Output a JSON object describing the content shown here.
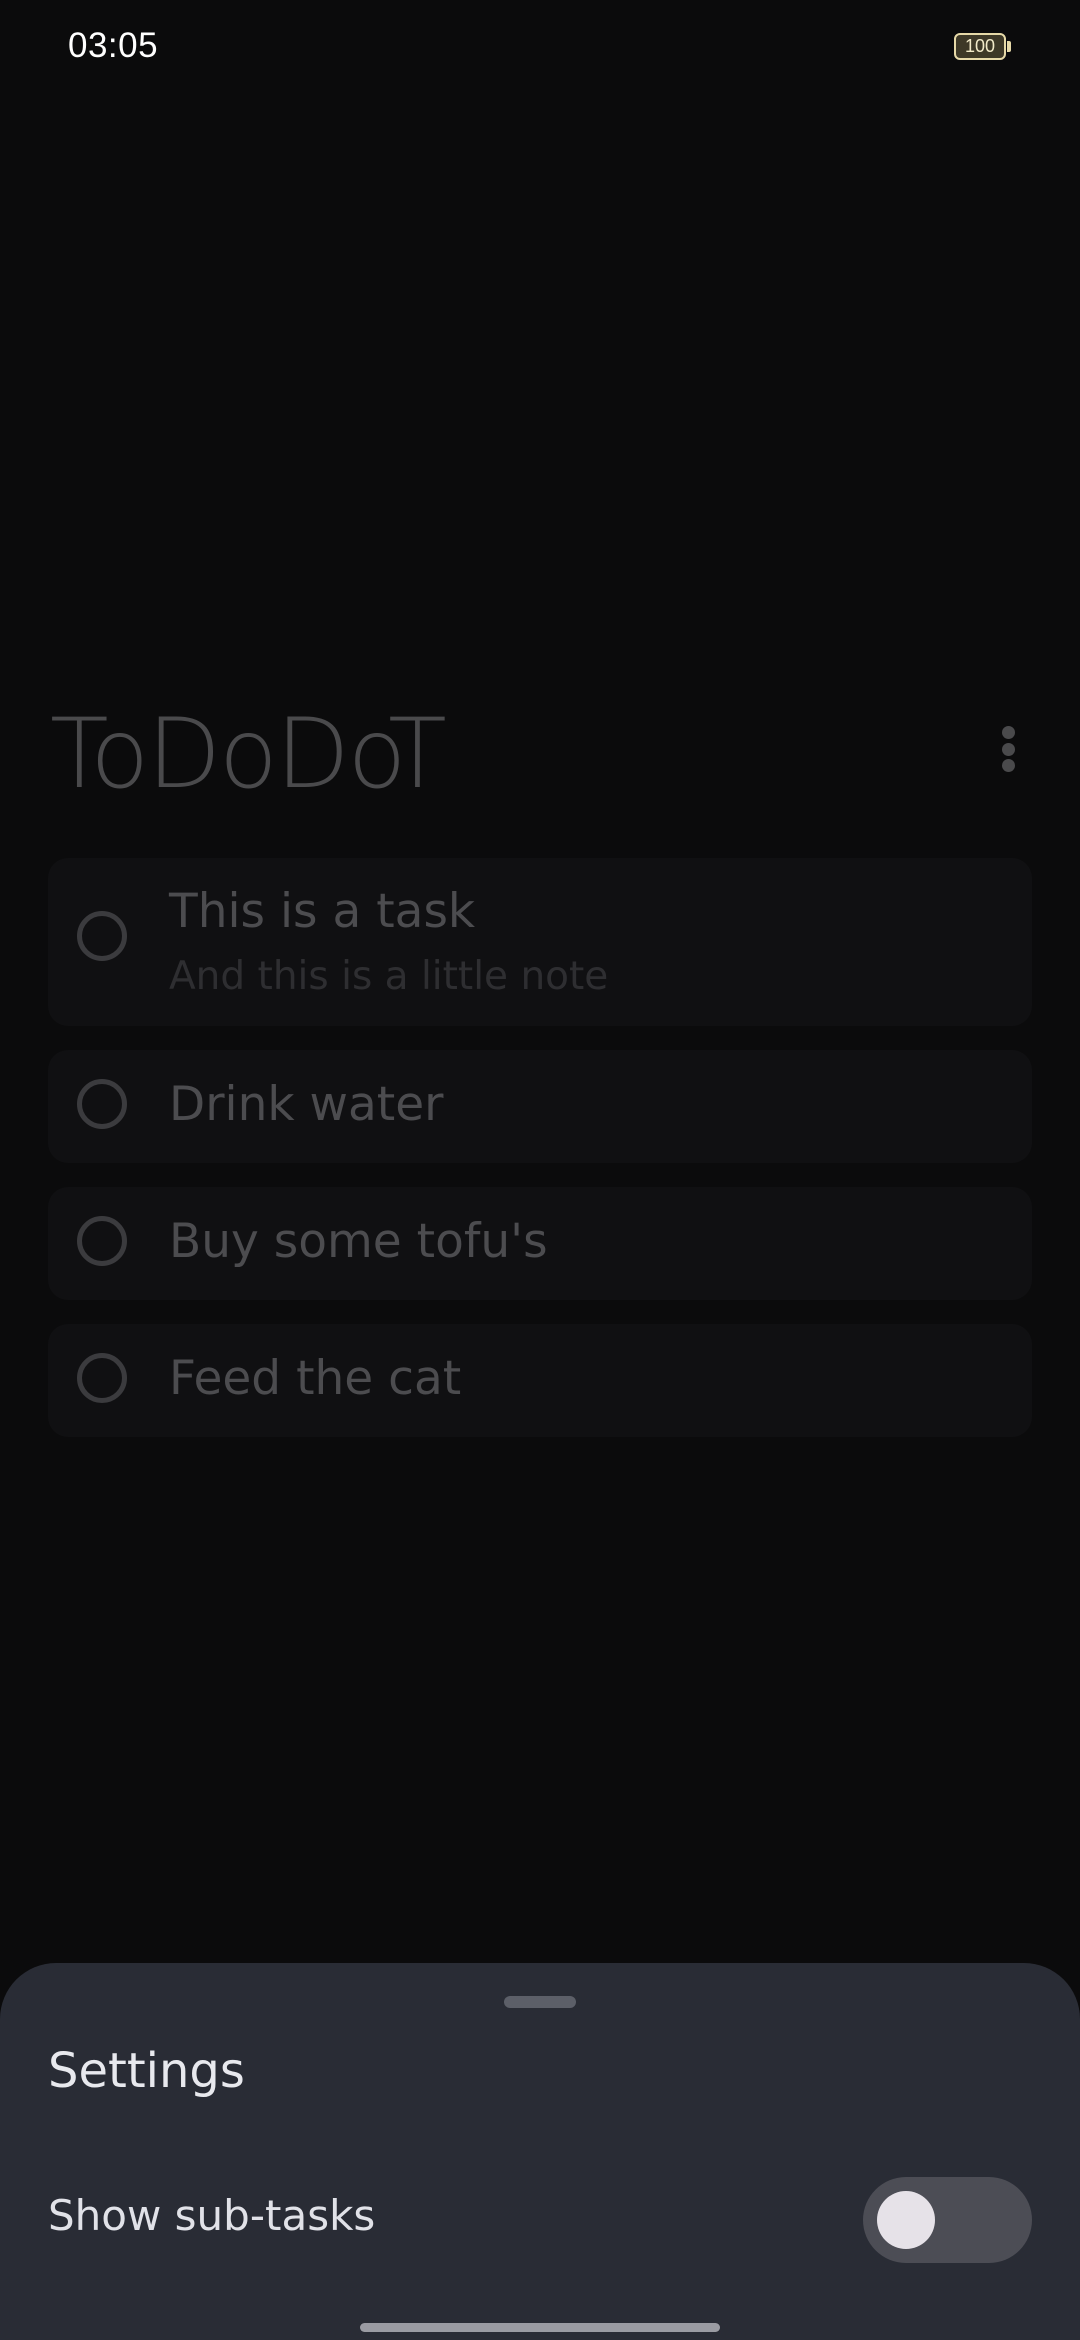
{
  "status_bar": {
    "time": "03:05",
    "battery_level": "100"
  },
  "app": {
    "title": "ToDoDoT",
    "menu_icon": "more-vert-icon"
  },
  "tasks": [
    {
      "title": "This is a task",
      "note": "And this is a little note",
      "completed": false
    },
    {
      "title": "Drink water",
      "completed": false
    },
    {
      "title": "Buy some tofu's",
      "completed": false
    },
    {
      "title": "Feed the cat",
      "completed": false
    }
  ],
  "settings_sheet": {
    "title": "Settings",
    "options": [
      {
        "label": "Show sub-tasks",
        "enabled": false
      }
    ]
  },
  "colors": {
    "background": "#0b0b0c",
    "card": "#101012",
    "sheet": "#292c35",
    "toggle_track": "#4c4d55",
    "toggle_knob": "#e6e2e8"
  }
}
